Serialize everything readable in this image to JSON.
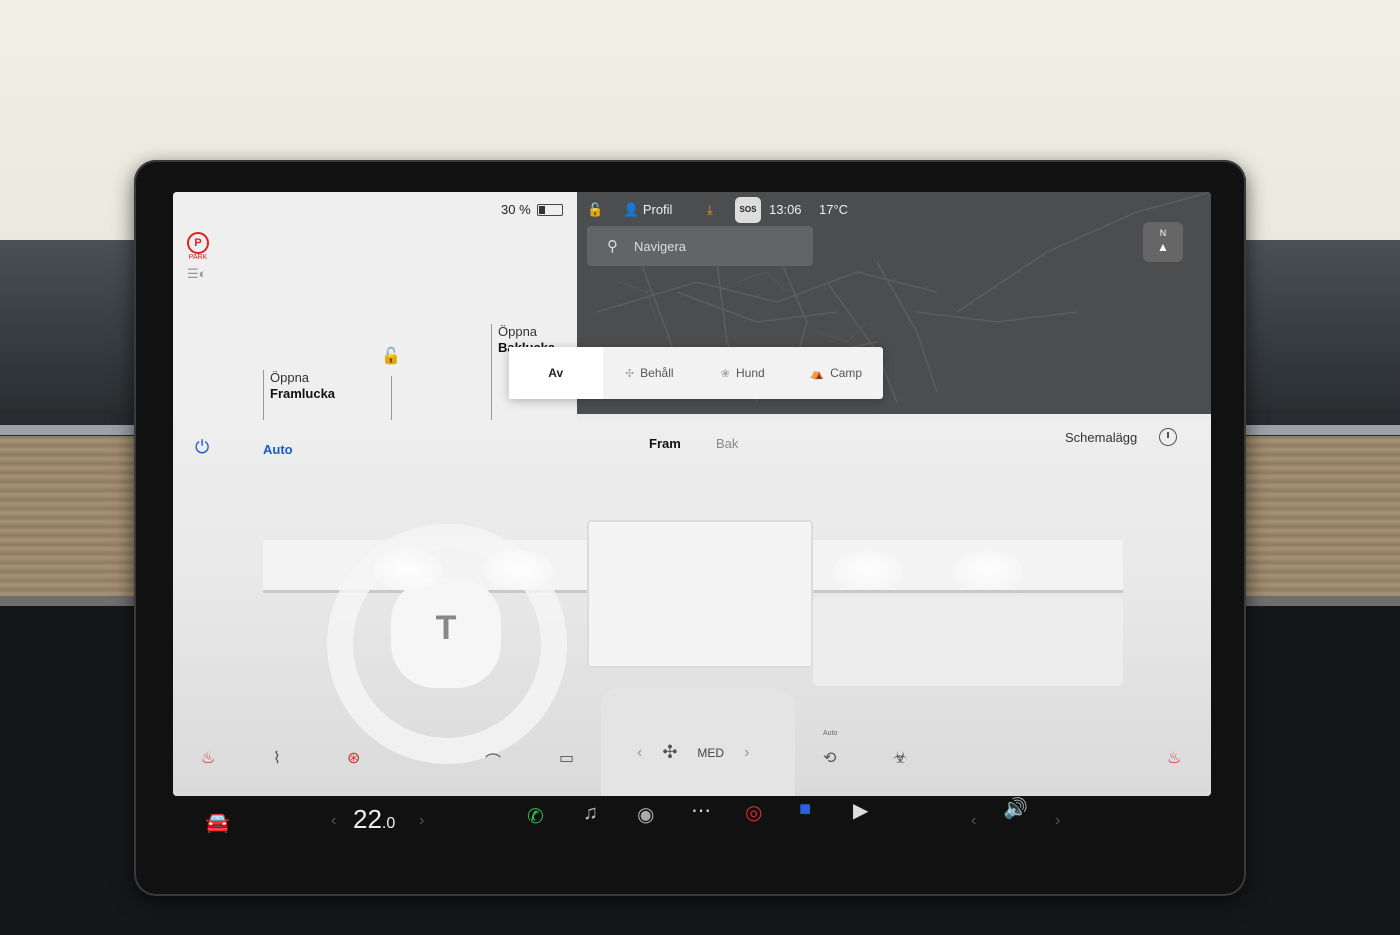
{
  "status_bar": {
    "battery": "30 %",
    "battery_level": 0.3,
    "profile": "Profil",
    "sos": "SOS",
    "time": "13:06",
    "outside_temp": "17°C"
  },
  "car_panel": {
    "park": "PARK",
    "park_letter": "P",
    "front_trunk_action": "Öppna",
    "front_trunk_label": "Framlucka",
    "rear_trunk_action": "Öppna",
    "rear_trunk_label": "Baklucka"
  },
  "map": {
    "search_placeholder": "Navigera",
    "compass_label": "N"
  },
  "climate_modes": [
    {
      "label": "Av",
      "icon": "off-icon",
      "active": true
    },
    {
      "label": "Behåll",
      "icon": "fan-icon",
      "active": false
    },
    {
      "label": "Hund",
      "icon": "paw-icon",
      "active": false
    },
    {
      "label": "Camp",
      "icon": "tent-icon",
      "active": false
    }
  ],
  "climate": {
    "auto": "Auto",
    "tabs": [
      "Fram",
      "Bak"
    ],
    "active_tab": "Fram",
    "schedule": "Schemalägg",
    "fan_speed": "MED",
    "auto_small": "Auto"
  },
  "taskbar": {
    "temp_int": "22",
    "temp_dec": ".0"
  },
  "colors": {
    "accent_blue": "#1a5bd0",
    "park_red": "#d22222",
    "phone_green": "#2fbf4a"
  }
}
